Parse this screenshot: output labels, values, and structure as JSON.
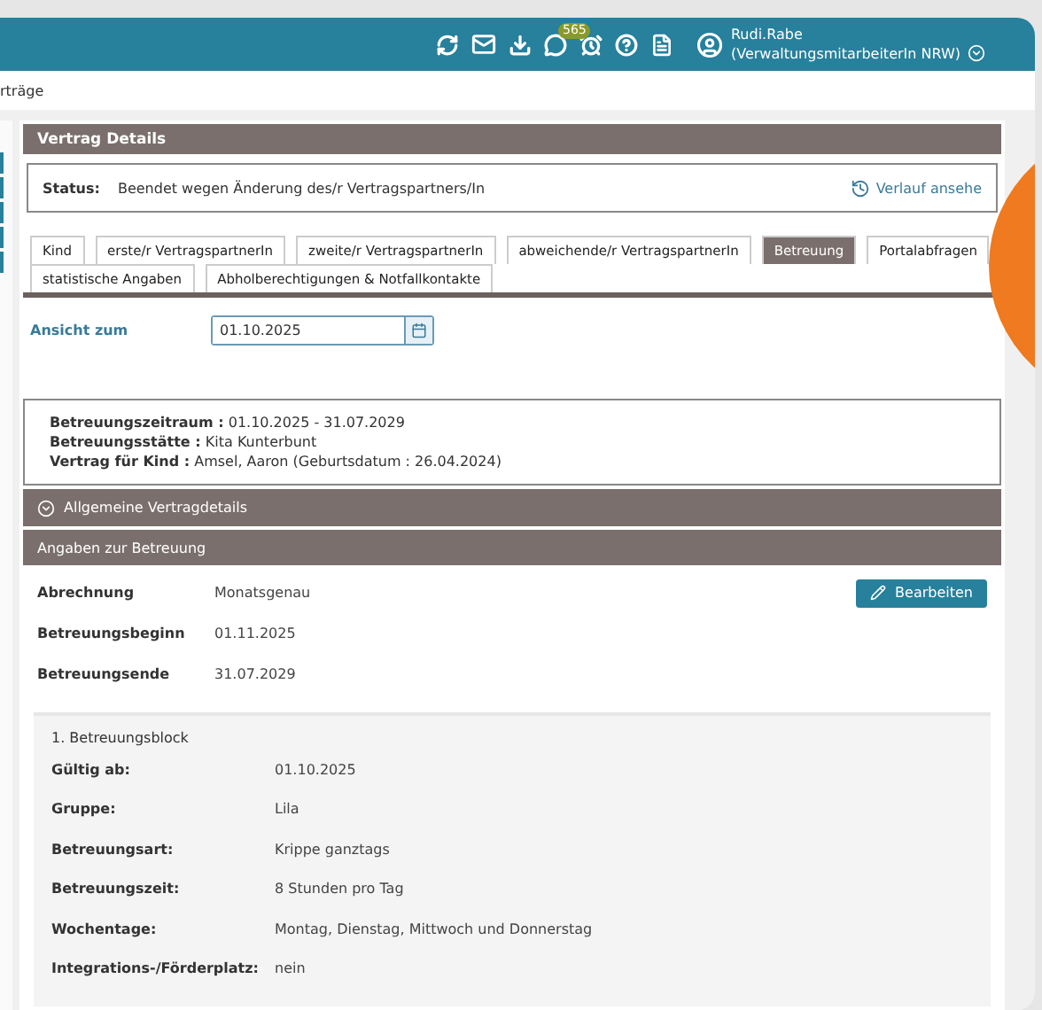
{
  "header": {
    "badge": "565",
    "user_name": "Rudi.Rabe",
    "user_role": "(VerwaltungsmitarbeiterIn NRW)"
  },
  "breadcrumb": "rträge",
  "panel": {
    "title": "Vertrag Details",
    "status_label": "Status:",
    "status_value": "Beendet wegen Änderung des/r Vertragspartners/In",
    "history_link": "Verlauf ansehe"
  },
  "tabs": [
    {
      "label": "Kind",
      "selected": false
    },
    {
      "label": "erste/r VertragspartnerIn",
      "selected": false
    },
    {
      "label": "zweite/r VertragspartnerIn",
      "selected": false
    },
    {
      "label": "abweichende/r VertragspartnerIn",
      "selected": false
    },
    {
      "label": "Betreuung",
      "selected": true
    },
    {
      "label": "Portalabfragen",
      "selected": false
    },
    {
      "label": "statistische Angaben",
      "selected": false
    },
    {
      "label": "Abholberechtigungen & Notfallkontakte",
      "selected": false
    }
  ],
  "view_date": {
    "label": "Ansicht zum",
    "value": "01.10.2025"
  },
  "summary": [
    {
      "label": "Betreuungszeitraum :",
      "value": "01.10.2025 - 31.07.2029"
    },
    {
      "label": "Betreuungsstätte :",
      "value": "Kita Kunterbunt"
    },
    {
      "label": "Vertrag für Kind :",
      "value": "Amsel, Aaron (Geburtsdatum : 26.04.2024)"
    }
  ],
  "general_section": {
    "title": "Allgemeine Vertragdetails",
    "expanded": false
  },
  "care_section": {
    "title": "Angaben zur Betreuung",
    "edit_button": "Bearbeiten",
    "fields": [
      {
        "label": "Abrechnung",
        "value": "Monatsgenau"
      },
      {
        "label": "Betreuungsbeginn",
        "value": "01.11.2025"
      },
      {
        "label": "Betreuungsende",
        "value": "31.07.2029"
      }
    ]
  },
  "care_block": {
    "title": "1. Betreuungsblock",
    "fields": [
      {
        "label": "Gültig ab:",
        "value": "01.10.2025"
      },
      {
        "label": "Gruppe:",
        "value": "Lila"
      },
      {
        "label": "Betreuungsart:",
        "value": "Krippe ganztags"
      },
      {
        "label": "Betreuungszeit:",
        "value": "8 Stunden pro Tag"
      },
      {
        "label": "Wochentage:",
        "value": "Montag, Dienstag, Mittwoch und Donnerstag"
      },
      {
        "label": "Integrations-/Förderplatz:",
        "value": "nein"
      }
    ]
  }
}
